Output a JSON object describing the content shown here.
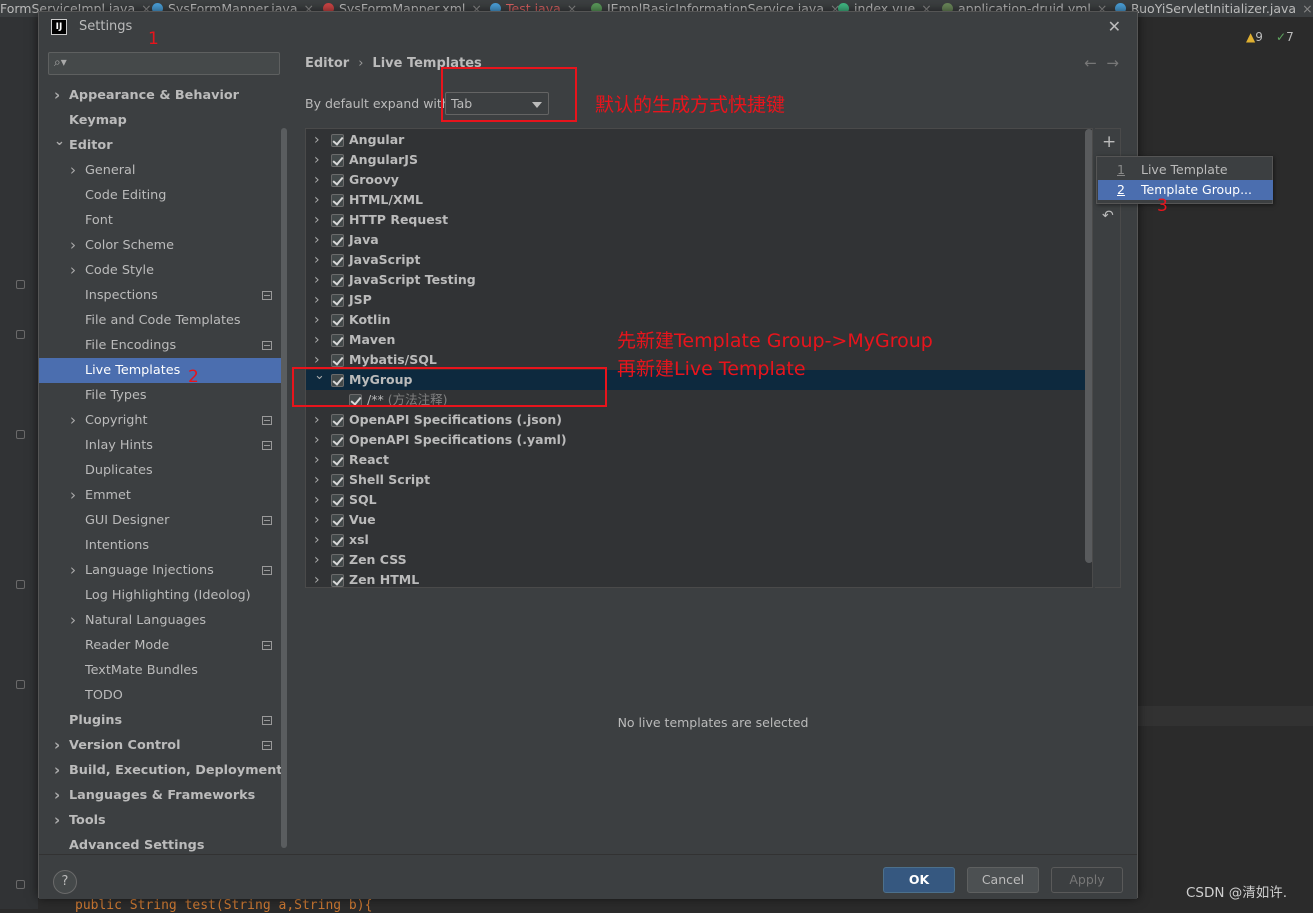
{
  "editor_tabs": [
    {
      "label": "FormServiceImpl.java",
      "color": "#4a9fd8"
    },
    {
      "label": "SysFormMapper.java",
      "color": "#4a9fd8"
    },
    {
      "label": "SysFormMapper.xml",
      "color": "#c44"
    },
    {
      "label": "Test.java",
      "color": "#4a9fd8",
      "active_color": "#d96060"
    },
    {
      "label": "IEmplBasicInformationService.java",
      "color": "#5a9a5a"
    },
    {
      "label": "index.vue",
      "color": "#41b883"
    },
    {
      "label": "application-druid.yml",
      "color": "#6a8759"
    },
    {
      "label": "RuoYiServletInitializer.java",
      "color": "#4a9fd8"
    }
  ],
  "inspection": {
    "warnings": "9",
    "weak": "7"
  },
  "dialog": {
    "title": "Settings",
    "logo": "IJ",
    "search_placeholder": ""
  },
  "sidebar": {
    "items": [
      {
        "label": "Appearance & Behavior",
        "level": 0,
        "bold": true,
        "arrow": "right"
      },
      {
        "label": "Keymap",
        "level": 0,
        "bold": true,
        "arrow": ""
      },
      {
        "label": "Editor",
        "level": 0,
        "bold": true,
        "arrow": "down"
      },
      {
        "label": "General",
        "level": 1,
        "bold": false,
        "arrow": "right"
      },
      {
        "label": "Code Editing",
        "level": 1,
        "bold": false,
        "arrow": ""
      },
      {
        "label": "Font",
        "level": 1,
        "bold": false,
        "arrow": ""
      },
      {
        "label": "Color Scheme",
        "level": 1,
        "bold": false,
        "arrow": "right"
      },
      {
        "label": "Code Style",
        "level": 1,
        "bold": false,
        "arrow": "right"
      },
      {
        "label": "Inspections",
        "level": 1,
        "bold": false,
        "arrow": "",
        "ext": true
      },
      {
        "label": "File and Code Templates",
        "level": 1,
        "bold": false,
        "arrow": ""
      },
      {
        "label": "File Encodings",
        "level": 1,
        "bold": false,
        "arrow": "",
        "ext": true
      },
      {
        "label": "Live Templates",
        "level": 1,
        "bold": false,
        "arrow": "",
        "selected": true
      },
      {
        "label": "File Types",
        "level": 1,
        "bold": false,
        "arrow": ""
      },
      {
        "label": "Copyright",
        "level": 1,
        "bold": false,
        "arrow": "right",
        "ext": true
      },
      {
        "label": "Inlay Hints",
        "level": 1,
        "bold": false,
        "arrow": "",
        "ext": true
      },
      {
        "label": "Duplicates",
        "level": 1,
        "bold": false,
        "arrow": ""
      },
      {
        "label": "Emmet",
        "level": 1,
        "bold": false,
        "arrow": "right"
      },
      {
        "label": "GUI Designer",
        "level": 1,
        "bold": false,
        "arrow": "",
        "ext": true
      },
      {
        "label": "Intentions",
        "level": 1,
        "bold": false,
        "arrow": ""
      },
      {
        "label": "Language Injections",
        "level": 1,
        "bold": false,
        "arrow": "right",
        "ext": true
      },
      {
        "label": "Log Highlighting (Ideolog)",
        "level": 1,
        "bold": false,
        "arrow": ""
      },
      {
        "label": "Natural Languages",
        "level": 1,
        "bold": false,
        "arrow": "right"
      },
      {
        "label": "Reader Mode",
        "level": 1,
        "bold": false,
        "arrow": "",
        "ext": true
      },
      {
        "label": "TextMate Bundles",
        "level": 1,
        "bold": false,
        "arrow": ""
      },
      {
        "label": "TODO",
        "level": 1,
        "bold": false,
        "arrow": ""
      },
      {
        "label": "Plugins",
        "level": 0,
        "bold": true,
        "arrow": "",
        "ext": true
      },
      {
        "label": "Version Control",
        "level": 0,
        "bold": true,
        "arrow": "right",
        "ext": true
      },
      {
        "label": "Build, Execution, Deployment",
        "level": 0,
        "bold": true,
        "arrow": "right"
      },
      {
        "label": "Languages & Frameworks",
        "level": 0,
        "bold": true,
        "arrow": "right"
      },
      {
        "label": "Tools",
        "level": 0,
        "bold": true,
        "arrow": "right"
      },
      {
        "label": "Advanced Settings",
        "level": 0,
        "bold": true,
        "arrow": ""
      }
    ]
  },
  "content": {
    "breadcrumb": [
      "Editor",
      "Live Templates"
    ],
    "breadcrumb_sep": "›",
    "expand_label": "By default expand with",
    "expand_value": "Tab",
    "empty_text": "No live templates are selected",
    "groups": [
      {
        "label": "Angular",
        "expanded": false
      },
      {
        "label": "AngularJS",
        "expanded": false
      },
      {
        "label": "Groovy",
        "expanded": false
      },
      {
        "label": "HTML/XML",
        "expanded": false
      },
      {
        "label": "HTTP Request",
        "expanded": false
      },
      {
        "label": "Java",
        "expanded": false
      },
      {
        "label": "JavaScript",
        "expanded": false
      },
      {
        "label": "JavaScript Testing",
        "expanded": false
      },
      {
        "label": "JSP",
        "expanded": false
      },
      {
        "label": "Kotlin",
        "expanded": false
      },
      {
        "label": "Maven",
        "expanded": false
      },
      {
        "label": "Mybatis/SQL",
        "expanded": false
      },
      {
        "label": "MyGroup",
        "expanded": true,
        "selected": true,
        "children": [
          {
            "abbr": "/**",
            "desc": "(方法注释)"
          }
        ]
      },
      {
        "label": "OpenAPI Specifications (.json)",
        "expanded": false
      },
      {
        "label": "OpenAPI Specifications (.yaml)",
        "expanded": false
      },
      {
        "label": "React",
        "expanded": false
      },
      {
        "label": "Shell Script",
        "expanded": false
      },
      {
        "label": "SQL",
        "expanded": false
      },
      {
        "label": "Vue",
        "expanded": false
      },
      {
        "label": "xsl",
        "expanded": false
      },
      {
        "label": "Zen CSS",
        "expanded": false
      },
      {
        "label": "Zen HTML",
        "expanded": false
      }
    ]
  },
  "add_popup": {
    "items": [
      {
        "num": "1",
        "label": "Live Template"
      },
      {
        "num": "2",
        "label": "Template Group...",
        "selected": true
      }
    ]
  },
  "footer": {
    "ok": "OK",
    "cancel": "Cancel",
    "apply": "Apply",
    "help": "?"
  },
  "annotations": {
    "n1": "1",
    "n2": "2",
    "n3": "3",
    "expand_note": "默认的生成方式快捷键",
    "group_note_1": "先新建Template Group->MyGroup",
    "group_note_2": "再新建Live Template",
    "color": "#e8141c"
  },
  "background_code": "public String test(String a,String b){",
  "watermark": "CSDN @清如许."
}
